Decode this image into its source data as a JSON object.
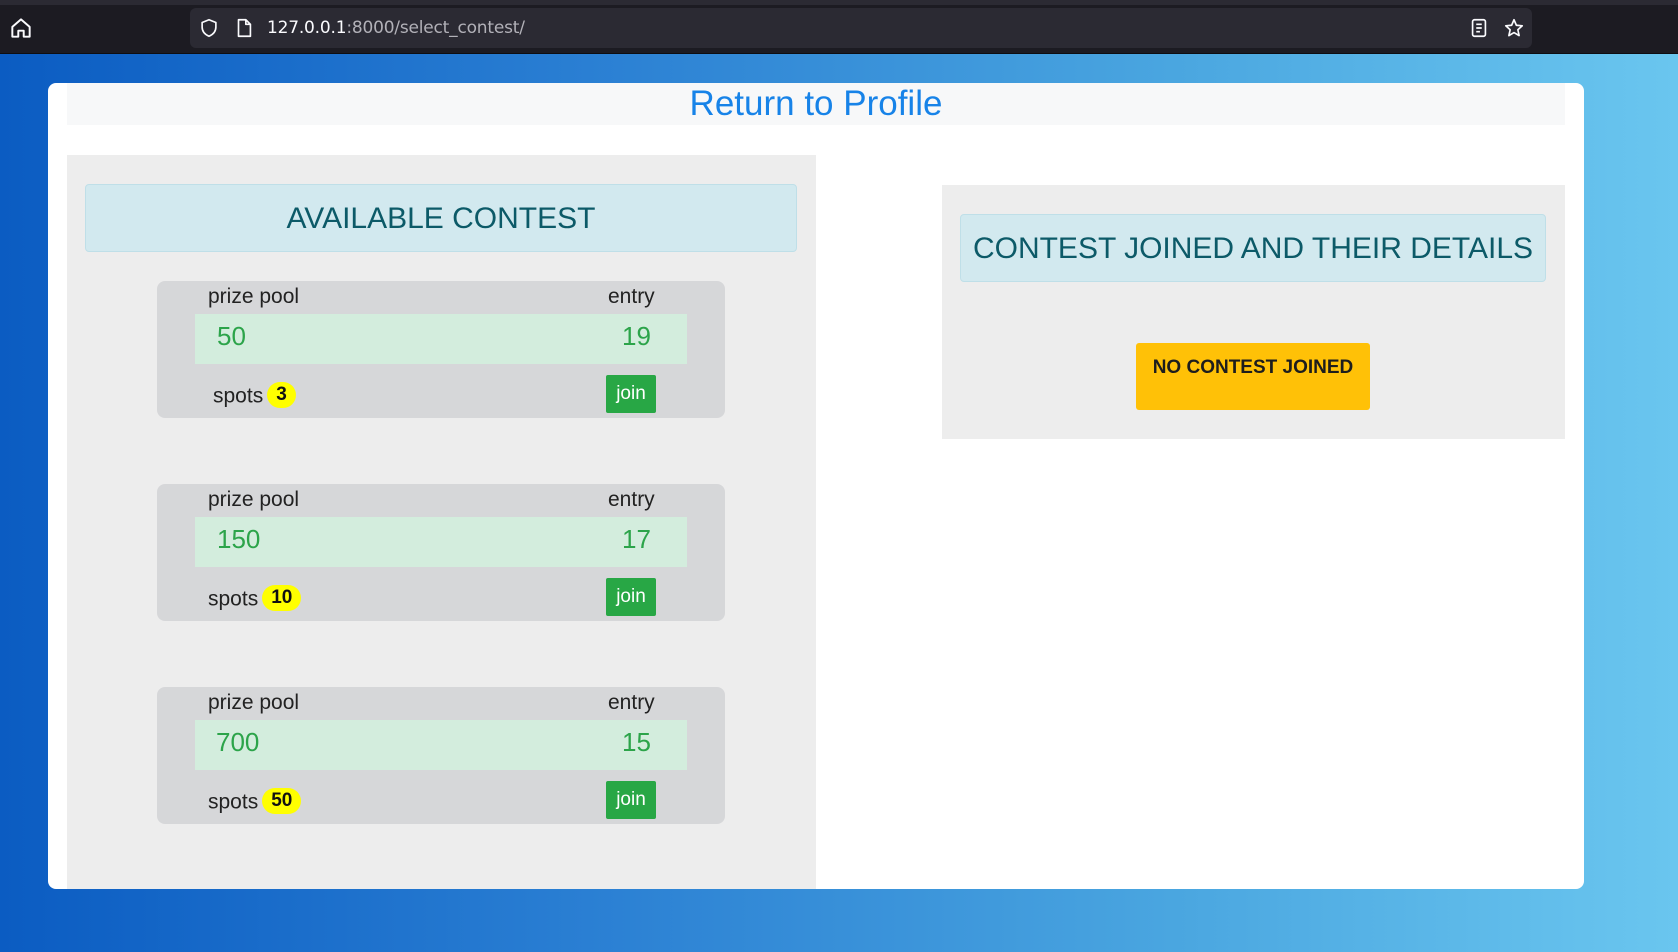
{
  "browser": {
    "url_host": "127.0.0.1",
    "url_rest": ":8000/select_contest/"
  },
  "nav": {
    "return_link": "Return to Profile"
  },
  "available": {
    "title": "AVAILABLE CONTEST",
    "contests": [
      {
        "prize_pool_label": "prize pool",
        "entry_label": "entry",
        "prize_pool": "50",
        "entry": "19",
        "spots_label": "spots",
        "spots": "3",
        "join_label": "join"
      },
      {
        "prize_pool_label": "prize pool",
        "entry_label": "entry",
        "prize_pool": "150",
        "entry": "17",
        "spots_label": "spots",
        "spots": "10",
        "join_label": "join"
      },
      {
        "prize_pool_label": "prize pool",
        "entry_label": "entry",
        "prize_pool": "700",
        "entry": "15",
        "spots_label": "spots",
        "spots": "50",
        "join_label": "join"
      }
    ]
  },
  "joined": {
    "title": "CONTEST JOINED AND THEIR DETAILS",
    "empty_label": "NO CONTEST JOINED"
  },
  "colors": {
    "link": "#1783e8",
    "success": "#28a745",
    "warning": "#ffc107",
    "badge": "#ffff00"
  }
}
